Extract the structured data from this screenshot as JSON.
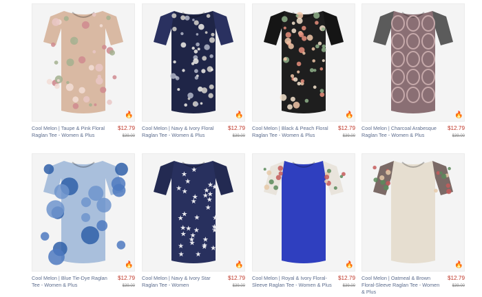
{
  "products": [
    {
      "title": "Cool Melon | Taupe & Pink Floral Raglan Tee - Women & Plus",
      "price": "$12.79",
      "original_price": "$39.00",
      "body_color": "#d9b9a3",
      "sleeve_color": "#d9b9a3",
      "pattern": "floral-taupe"
    },
    {
      "title": "Cool Melon | Navy & Ivory Floral Raglan Tee - Women & Plus",
      "price": "$12.79",
      "original_price": "$39.00",
      "body_color": "#1f2547",
      "sleeve_color": "#2a3160",
      "pattern": "floral-navy"
    },
    {
      "title": "Cool Melon | Black & Peach Floral Raglan Tee - Women & Plus",
      "price": "$12.79",
      "original_price": "$39.00",
      "body_color": "#1e1e1e",
      "sleeve_color": "#151515",
      "pattern": "floral-black"
    },
    {
      "title": "Cool Melon | Charcoal Arabesque Raglan Tee - Women & Plus",
      "price": "$12.79",
      "original_price": "$39.00",
      "body_color": "#8a6f74",
      "sleeve_color": "#5b5b5b",
      "pattern": "arabesque"
    },
    {
      "title": "Cool Melon | Blue Tie-Dye Raglan Tee - Women & Plus",
      "price": "$12.79",
      "original_price": "$39.00",
      "body_color": "#a9bfdc",
      "sleeve_color": "#a9bfdc",
      "pattern": "tiedye"
    },
    {
      "title": "Cool Melon | Navy & Ivory Star Raglan Tee - Women",
      "price": "$12.79",
      "original_price": "$39.00",
      "body_color": "#28305e",
      "sleeve_color": "#232a52",
      "pattern": "stars"
    },
    {
      "title": "Cool Melon | Royal & Ivory Floral-Sleeve Raglan Tee - Women & Plus",
      "price": "$12.79",
      "original_price": "$39.00",
      "body_color": "#2f3fbf",
      "sleeve_color": "#e9e4dc",
      "pattern": "solid-floral-sleeve"
    },
    {
      "title": "Cool Melon | Oatmeal & Brown Floral-Sleeve Raglan Tee - Women & Plus",
      "price": "$12.79",
      "original_price": "$39.00",
      "body_color": "#e6ded0",
      "sleeve_color": "#7b6a66",
      "pattern": "solid-floral-sleeve"
    }
  ],
  "badge_icon": "flame-icon",
  "accent_price_color": "#c0392b"
}
